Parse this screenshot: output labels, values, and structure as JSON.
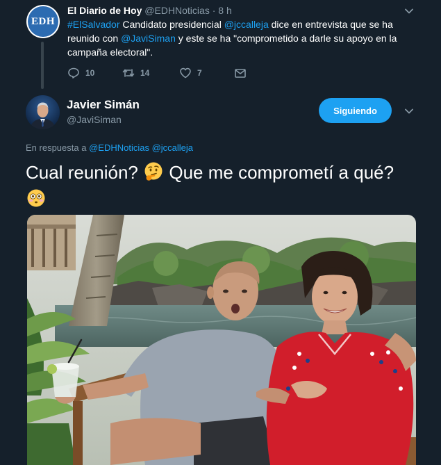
{
  "parent_tweet": {
    "avatar_text": "EDH",
    "name": "El Diario de Hoy",
    "handle": "@EDHNoticias",
    "separator": "·",
    "time": "8 h",
    "text_parts": [
      "#ElSalvador",
      " Candidato presidencial ",
      "@jccalleja",
      " dice en entrevista que se ha reunido con ",
      "@JaviSiman",
      " y este se ha \"comprometido a darle su apoyo en la campaña electoral\"."
    ],
    "actions": {
      "replies": "10",
      "retweets": "14",
      "likes": "7"
    }
  },
  "reply_tweet": {
    "name": "Javier Simán",
    "handle": "@JaviSiman",
    "follow_label": "Siguiendo",
    "reply_to_prefix": "En respuesta a",
    "reply_to_1": "@EDHNoticias",
    "reply_to_2": "@jccalleja",
    "text_1": "Cual reunión?",
    "text_2": "Que me comprometí a qué?"
  },
  "icons": {
    "caret": "chevron-down-icon",
    "reply": "reply-icon",
    "retweet": "retweet-icon",
    "like": "heart-icon",
    "dm": "envelope-icon",
    "emoji_1": "thinking-face-emoji",
    "emoji_2": "flushed-face-emoji"
  },
  "colors": {
    "background": "#15202b",
    "accent": "#1da1f2",
    "muted": "#8899a6"
  }
}
